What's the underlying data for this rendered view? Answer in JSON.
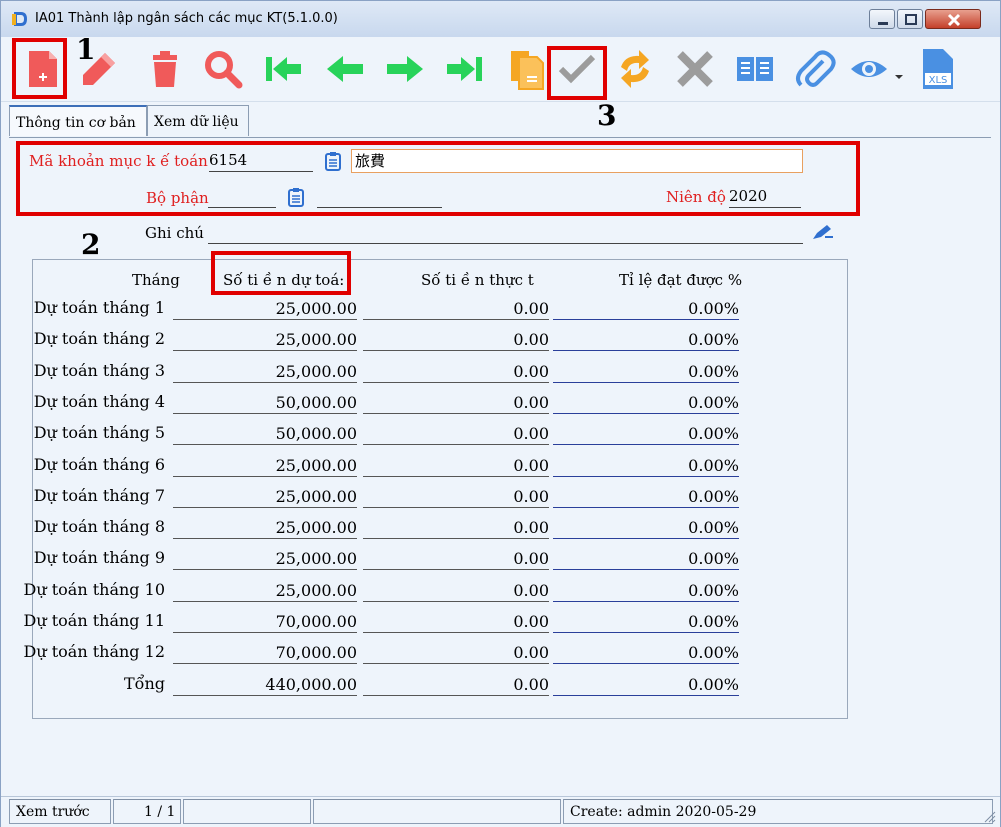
{
  "window": {
    "title": "IA01 Thành lập ngân sách các mục KT(5.1.0.0)"
  },
  "toolbar": {
    "buttons": [
      {
        "name": "new-icon",
        "color": "#f05a5a"
      },
      {
        "name": "edit-icon",
        "color": "#f05a5a"
      },
      {
        "name": "delete-icon",
        "color": "#f05a5a"
      },
      {
        "name": "search-icon",
        "color": "#f05a5a"
      },
      {
        "name": "first-record-icon",
        "color": "#28d35a"
      },
      {
        "name": "previous-record-icon",
        "color": "#28d35a"
      },
      {
        "name": "next-record-icon",
        "color": "#28d35a"
      },
      {
        "name": "last-record-icon",
        "color": "#28d35a"
      },
      {
        "name": "copy-icon",
        "color": "#f5a623"
      },
      {
        "name": "confirm-check-icon",
        "color": "#9c9c9c"
      },
      {
        "name": "refresh-icon",
        "color": "#f5a623"
      },
      {
        "name": "cancel-x-icon",
        "color": "#9c9c9c"
      },
      {
        "name": "book-icon",
        "color": "#4a90e2"
      },
      {
        "name": "attachment-icon",
        "color": "#4a90e2"
      },
      {
        "name": "preview-eye-icon",
        "color": "#4a90e2"
      },
      {
        "name": "export-xls-icon",
        "color": "#4a90e2"
      }
    ]
  },
  "annotations": {
    "m1": "1",
    "m2": "2",
    "m3": "3"
  },
  "tabs": {
    "basic_info": "Thông tin cơ bản",
    "view_data": "Xem dữ liệu"
  },
  "form": {
    "account_code_label": "Mã khoản mục k ế toán",
    "account_code_value": "6154",
    "account_name_value": "旅費",
    "department_label": "Bộ phận",
    "department_value": "",
    "department_name_value": "",
    "fiscal_year_label": "Niên độ",
    "fiscal_year_value": "2020",
    "note_label": "Ghi chú",
    "note_value": ""
  },
  "table": {
    "headers": [
      "Tháng",
      "Số ti ề n dự toá:",
      "Số ti ề n thực t",
      "Tỉ lệ đạt được %"
    ],
    "rows": [
      {
        "label": "Dự toán tháng 1",
        "budget": "25,000.00",
        "actual": "0.00",
        "rate": "0.00%"
      },
      {
        "label": "Dự toán tháng 2",
        "budget": "25,000.00",
        "actual": "0.00",
        "rate": "0.00%"
      },
      {
        "label": "Dự toán tháng 3",
        "budget": "25,000.00",
        "actual": "0.00",
        "rate": "0.00%"
      },
      {
        "label": "Dự toán tháng 4",
        "budget": "50,000.00",
        "actual": "0.00",
        "rate": "0.00%"
      },
      {
        "label": "Dự toán tháng 5",
        "budget": "50,000.00",
        "actual": "0.00",
        "rate": "0.00%"
      },
      {
        "label": "Dự toán tháng 6",
        "budget": "25,000.00",
        "actual": "0.00",
        "rate": "0.00%"
      },
      {
        "label": "Dự toán tháng 7",
        "budget": "25,000.00",
        "actual": "0.00",
        "rate": "0.00%"
      },
      {
        "label": "Dự toán tháng 8",
        "budget": "25,000.00",
        "actual": "0.00",
        "rate": "0.00%"
      },
      {
        "label": "Dự toán tháng 9",
        "budget": "25,000.00",
        "actual": "0.00",
        "rate": "0.00%"
      },
      {
        "label": "Dự toán tháng 10",
        "budget": "25,000.00",
        "actual": "0.00",
        "rate": "0.00%"
      },
      {
        "label": "Dự toán tháng 11",
        "budget": "70,000.00",
        "actual": "0.00",
        "rate": "0.00%"
      },
      {
        "label": "Dự toán tháng 12",
        "budget": "70,000.00",
        "actual": "0.00",
        "rate": "0.00%"
      },
      {
        "label": "Tổng",
        "budget": "440,000.00",
        "actual": "0.00",
        "rate": "0.00%"
      }
    ]
  },
  "status": {
    "preview": "Xem trước",
    "page": "1 / 1",
    "blank1": "",
    "blank2": "",
    "created": "Create: admin 2020-05-29"
  }
}
